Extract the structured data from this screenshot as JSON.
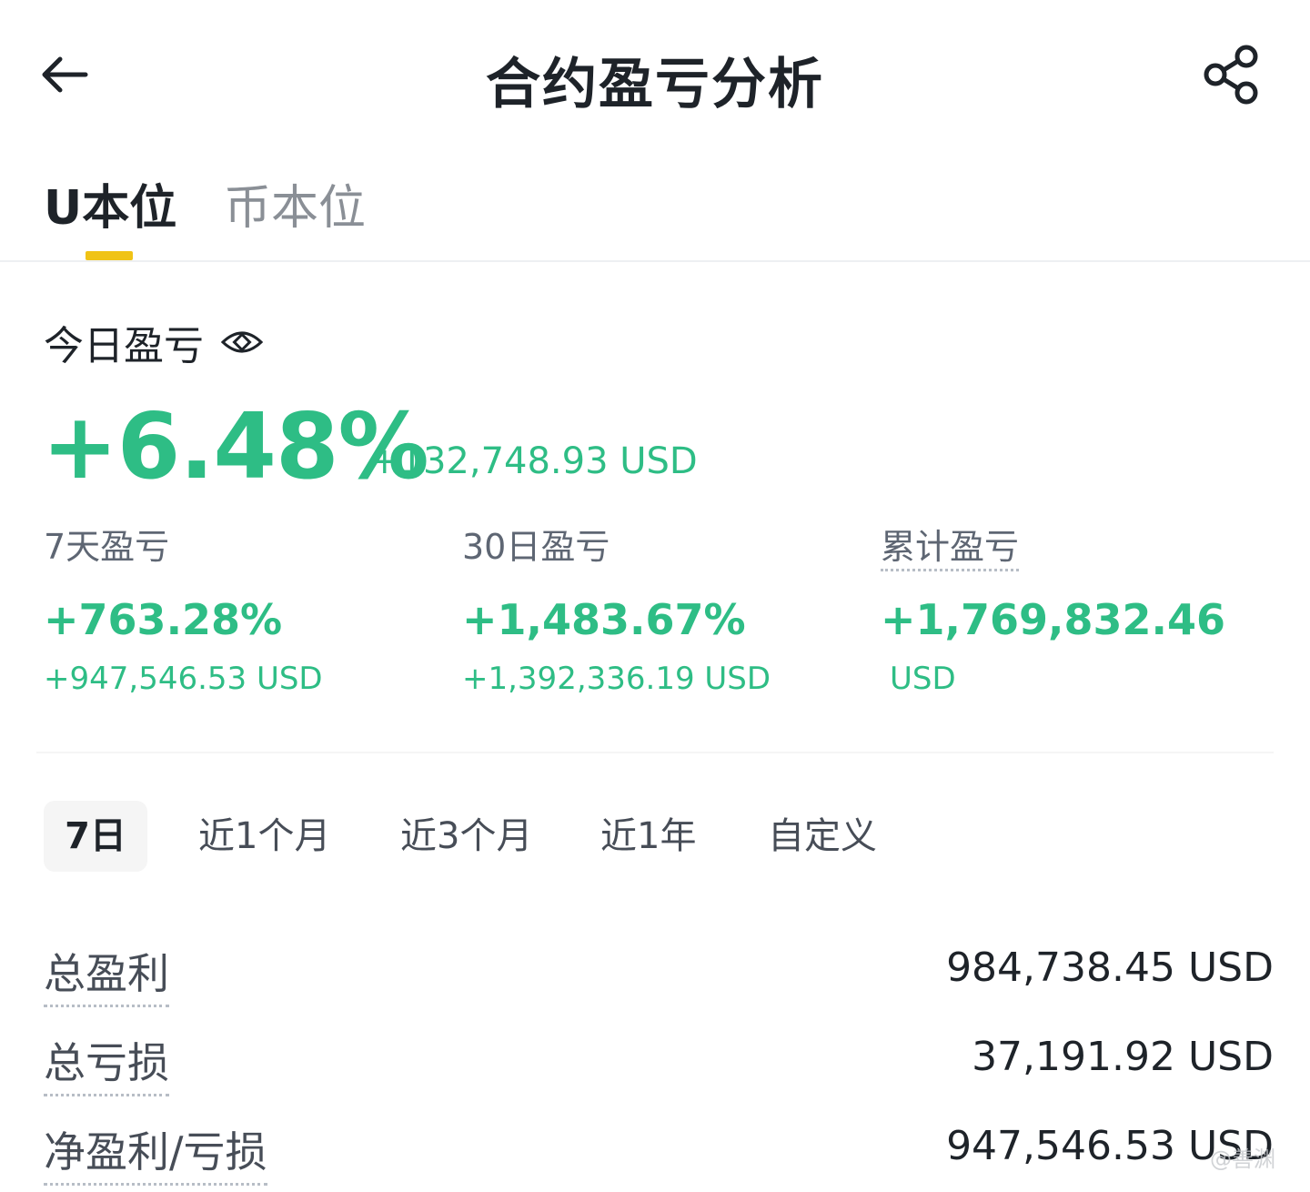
{
  "header": {
    "title": "合约盈亏分析",
    "back_icon": "arrow-left-icon",
    "share_icon": "share-icon"
  },
  "tabs": [
    {
      "label": "U本位",
      "active": true
    },
    {
      "label": "币本位",
      "active": false
    }
  ],
  "today": {
    "label": "今日盈亏",
    "percent": "+6.48%",
    "usd": "+132,748.93 USD"
  },
  "stats": [
    {
      "label": "7天盈亏",
      "percent": "+763.28%",
      "usd": "+947,546.53 USD"
    },
    {
      "label": "30日盈亏",
      "percent": "+1,483.67%",
      "usd": "+1,392,336.19 USD"
    },
    {
      "label": "累计盈亏",
      "percent": "+1,769,832.46",
      "usd": "USD"
    }
  ],
  "periods": [
    {
      "label": "7日",
      "active": true
    },
    {
      "label": "近1个月",
      "active": false
    },
    {
      "label": "近3个月",
      "active": false
    },
    {
      "label": "近1年",
      "active": false
    },
    {
      "label": "自定义",
      "active": false
    }
  ],
  "summary": [
    {
      "label": "总盈利",
      "value": "984,738.45 USD"
    },
    {
      "label": "总亏损",
      "value": "37,191.92 USD"
    },
    {
      "label": "净盈利/亏损",
      "value": "947,546.53 USD"
    }
  ],
  "watermark": "@善渊",
  "colors": {
    "profit_green": "#2ebd85",
    "accent_yellow": "#f0c316",
    "text_primary": "#1e2329",
    "text_secondary": "#5e6673"
  }
}
